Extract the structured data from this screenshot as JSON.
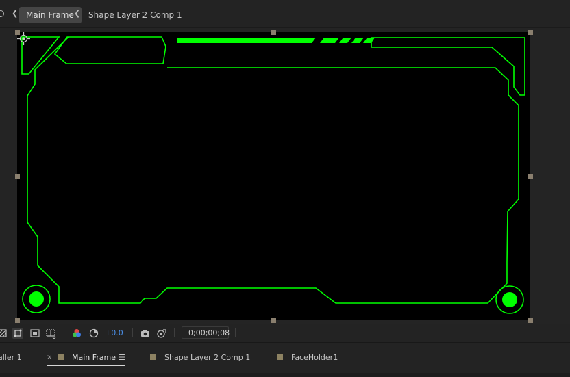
{
  "breadcrumbs": {
    "active": "Main Frame",
    "next": "Shape Layer 2 Comp 1"
  },
  "viewer": {
    "background": "#000000",
    "accent": "#00FF00"
  },
  "toolbar": {
    "exposure": "+0.0",
    "timecode": "0;00;00;08"
  },
  "tabs": {
    "partial": "aller 1",
    "active": "Main Frame",
    "second": "Shape Layer 2 Comp 1",
    "third": "FaceHolder1",
    "close_glyph": "×",
    "menu_glyph": "☰"
  },
  "colors": {
    "label_swatch": "#8D8262",
    "highlight": "#2D6BBF"
  }
}
